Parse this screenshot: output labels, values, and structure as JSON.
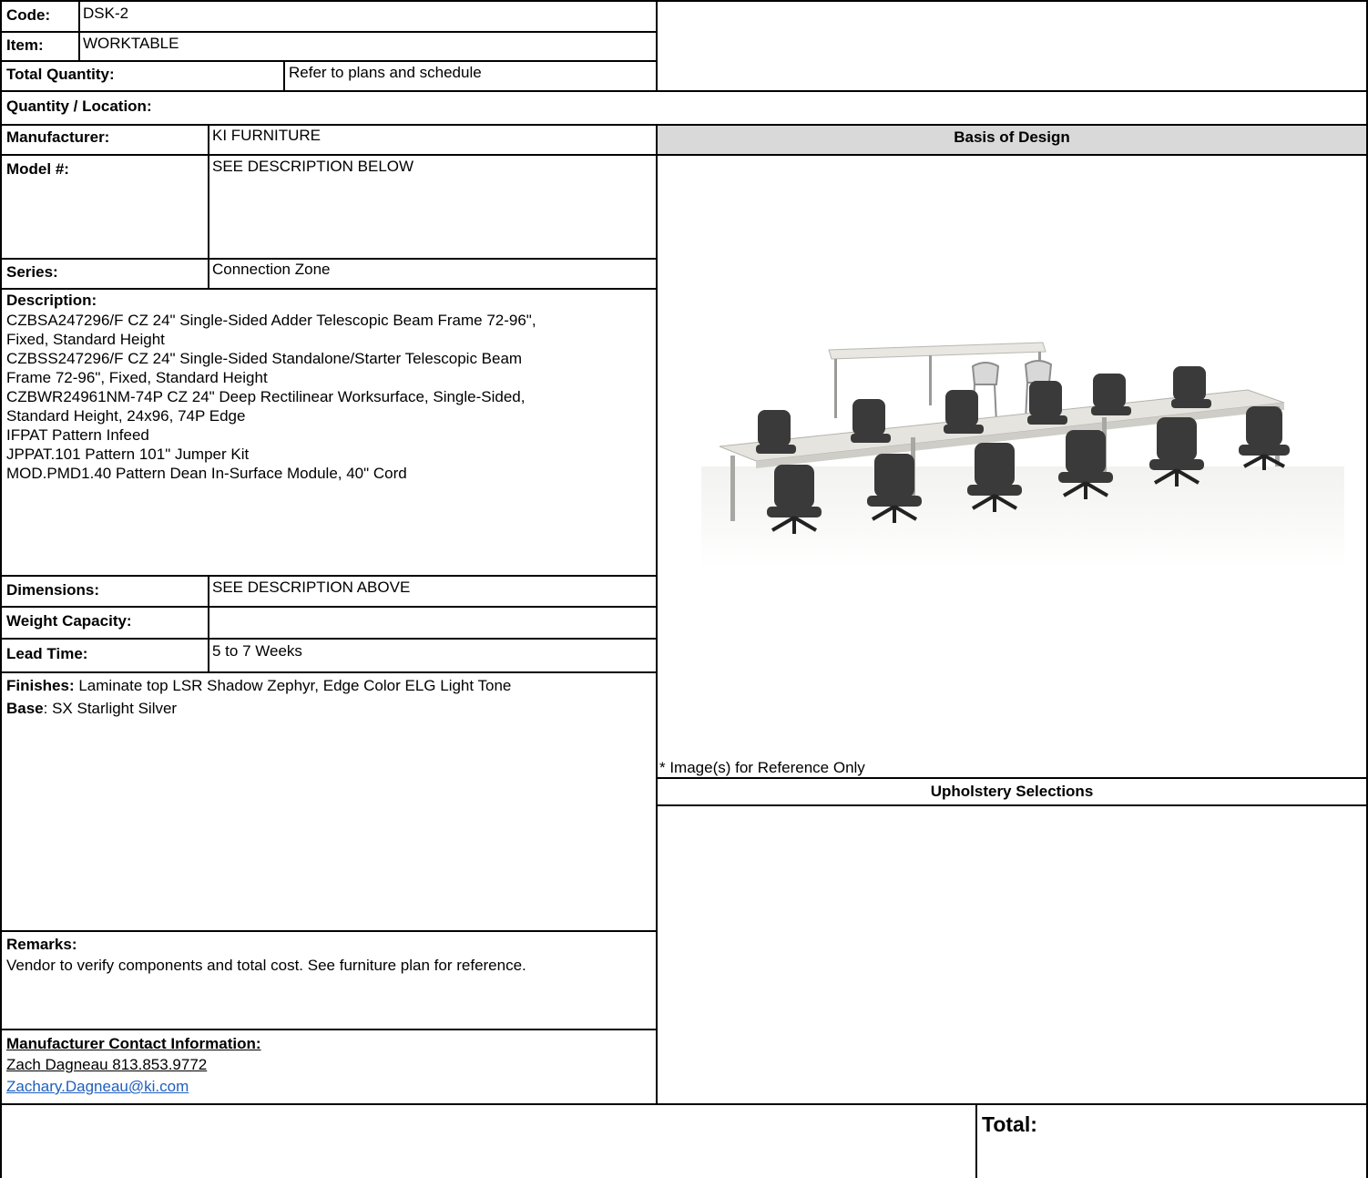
{
  "header": {
    "code_label": "Code:",
    "code_value": "DSK-2",
    "item_label": "Item:",
    "item_value": "WORKTABLE",
    "total_quantity_label": "Total Quantity:",
    "total_quantity_value": "Refer to plans and schedule",
    "quantity_location_label": "Quantity / Location:"
  },
  "spec": {
    "manufacturer_label": "Manufacturer:",
    "manufacturer_value": "KI FURNITURE",
    "model_label": "Model #:",
    "model_value": "SEE DESCRIPTION BELOW",
    "series_label": "Series:",
    "series_value": "Connection Zone",
    "description_label": "Description:",
    "description_lines": [
      "CZBSA247296/F CZ 24\" Single-Sided Adder Telescopic Beam Frame 72-96\",",
      "Fixed, Standard Height",
      "CZBSS247296/F CZ 24\" Single-Sided Standalone/Starter Telescopic Beam",
      "Frame 72-96\", Fixed, Standard Height",
      "CZBWR24961NM-74P CZ 24\" Deep Rectilinear Worksurface, Single-Sided,",
      "Standard Height, 24x96, 74P Edge",
      "IFPAT Pattern Infeed",
      "JPPAT.101 Pattern 101\" Jumper Kit",
      "MOD.PMD1.40 Pattern Dean In-Surface Module, 40\" Cord"
    ],
    "dimensions_label": "Dimensions:",
    "dimensions_value": "SEE DESCRIPTION ABOVE",
    "weight_label": "Weight Capacity:",
    "weight_value": "",
    "lead_time_label": "Lead Time:",
    "lead_time_value": "5 to 7 Weeks",
    "finishes_label": "Finishes:",
    "finishes_value": " Laminate top LSR Shadow Zephyr, Edge Color ELG Light Tone",
    "base_label": "Base",
    "base_value": ": SX Starlight Silver",
    "remarks_label": "Remarks:",
    "remarks_value": "Vendor to verify components and total cost. See furniture plan for reference.",
    "contact_label": "Manufacturer Contact Information:",
    "contact_name": "Zach Dagneau 813.853.9772",
    "contact_email": "Zachary.Dagneau@ki.com"
  },
  "right": {
    "basis_header": "Basis of Design",
    "image_note": "* Image(s) for Reference Only",
    "upholstery_header": "Upholstery Selections"
  },
  "footer": {
    "total_label": "Total:"
  },
  "colors": {
    "header_grey": "#d9d9d9",
    "link_blue": "#1f5fbf"
  }
}
